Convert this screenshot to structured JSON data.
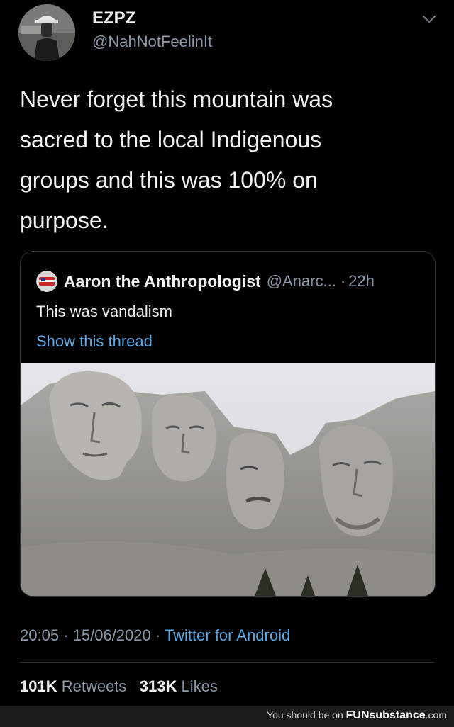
{
  "tweet": {
    "author": {
      "display_name": "EZPZ",
      "handle": "@NahNotFeelinIt"
    },
    "text": "Never forget this mountain was\nsacred to the local Indigenous\ngroups and this was 100% on\npurpose.",
    "quote": {
      "author_name": "Aaron the Anthropologist",
      "author_handle": "@Anarc...",
      "separator": "·",
      "time": "22h",
      "text": "This was vandalism",
      "show_thread_label": "Show this thread"
    },
    "meta": {
      "time": "20:05",
      "date": "15/06/2020",
      "separator": "·",
      "source": "Twitter for Android"
    },
    "stats": {
      "retweets_count": "101K",
      "retweets_label": "Retweets",
      "likes_count": "313K",
      "likes_label": "Likes"
    }
  },
  "watermark": {
    "prefix": "You should be on ",
    "brand": "FUNsubstance",
    "suffix": ".com"
  },
  "colors": {
    "background": "#000000",
    "text_primary": "#f2f2f2",
    "text_secondary": "#8b98a5",
    "link": "#5aa9e6",
    "border": "#2f3336"
  },
  "icons": {
    "more": "chevron-down-icon"
  }
}
